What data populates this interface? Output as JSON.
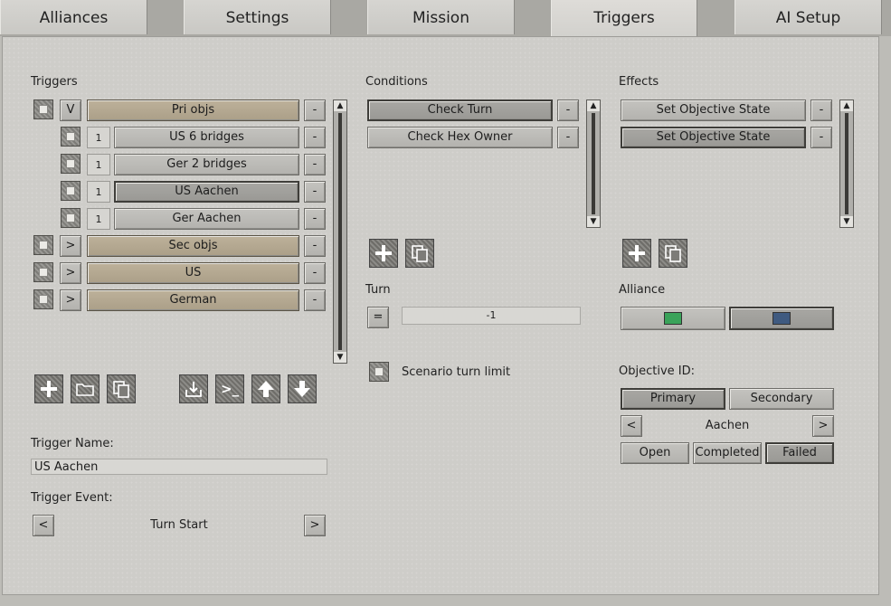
{
  "tabs": [
    {
      "label": "Alliances"
    },
    {
      "label": "Settings"
    },
    {
      "label": "Mission"
    },
    {
      "label": "Triggers"
    },
    {
      "label": "AI Setup"
    }
  ],
  "triggers": {
    "title": "Triggers",
    "rows": [
      {
        "toggle": "V",
        "name": "Pri objs",
        "remove": "-"
      },
      {
        "num": "1",
        "name": "US 6 bridges",
        "remove": "-"
      },
      {
        "num": "1",
        "name": "Ger 2 bridges",
        "remove": "-"
      },
      {
        "num": "1",
        "name": "US Aachen",
        "remove": "-"
      },
      {
        "num": "1",
        "name": "Ger Aachen",
        "remove": "-"
      },
      {
        "toggle": ">",
        "name": "Sec objs",
        "remove": "-"
      },
      {
        "toggle": ">",
        "name": "US",
        "remove": "-"
      },
      {
        "toggle": ">",
        "name": "German",
        "remove": "-"
      }
    ],
    "name_label": "Trigger Name:",
    "name_value": "US Aachen",
    "event_label": "Trigger Event:",
    "event_value": "Turn Start",
    "prev": "<",
    "next": ">"
  },
  "conditions": {
    "title": "Conditions",
    "items": [
      {
        "name": "Check Turn",
        "remove": "-"
      },
      {
        "name": "Check Hex Owner",
        "remove": "-"
      }
    ],
    "turn_label": "Turn",
    "turn_op": "=",
    "turn_value": "-1",
    "scenario_limit_label": "Scenario turn limit"
  },
  "effects": {
    "title": "Effects",
    "items": [
      {
        "name": "Set Objective State",
        "remove": "-"
      },
      {
        "name": "Set Objective State",
        "remove": "-"
      }
    ],
    "alliance_label": "Alliance",
    "alliance_colors": [
      "#3aa35a",
      "#3f5a80"
    ],
    "objective_label": "Objective ID:",
    "primary": "Primary",
    "secondary": "Secondary",
    "objective_value": "Aachen",
    "prev": "<",
    "next": ">",
    "open": "Open",
    "completed": "Completed",
    "failed": "Failed"
  },
  "icons": {
    "prompt": ">_"
  }
}
